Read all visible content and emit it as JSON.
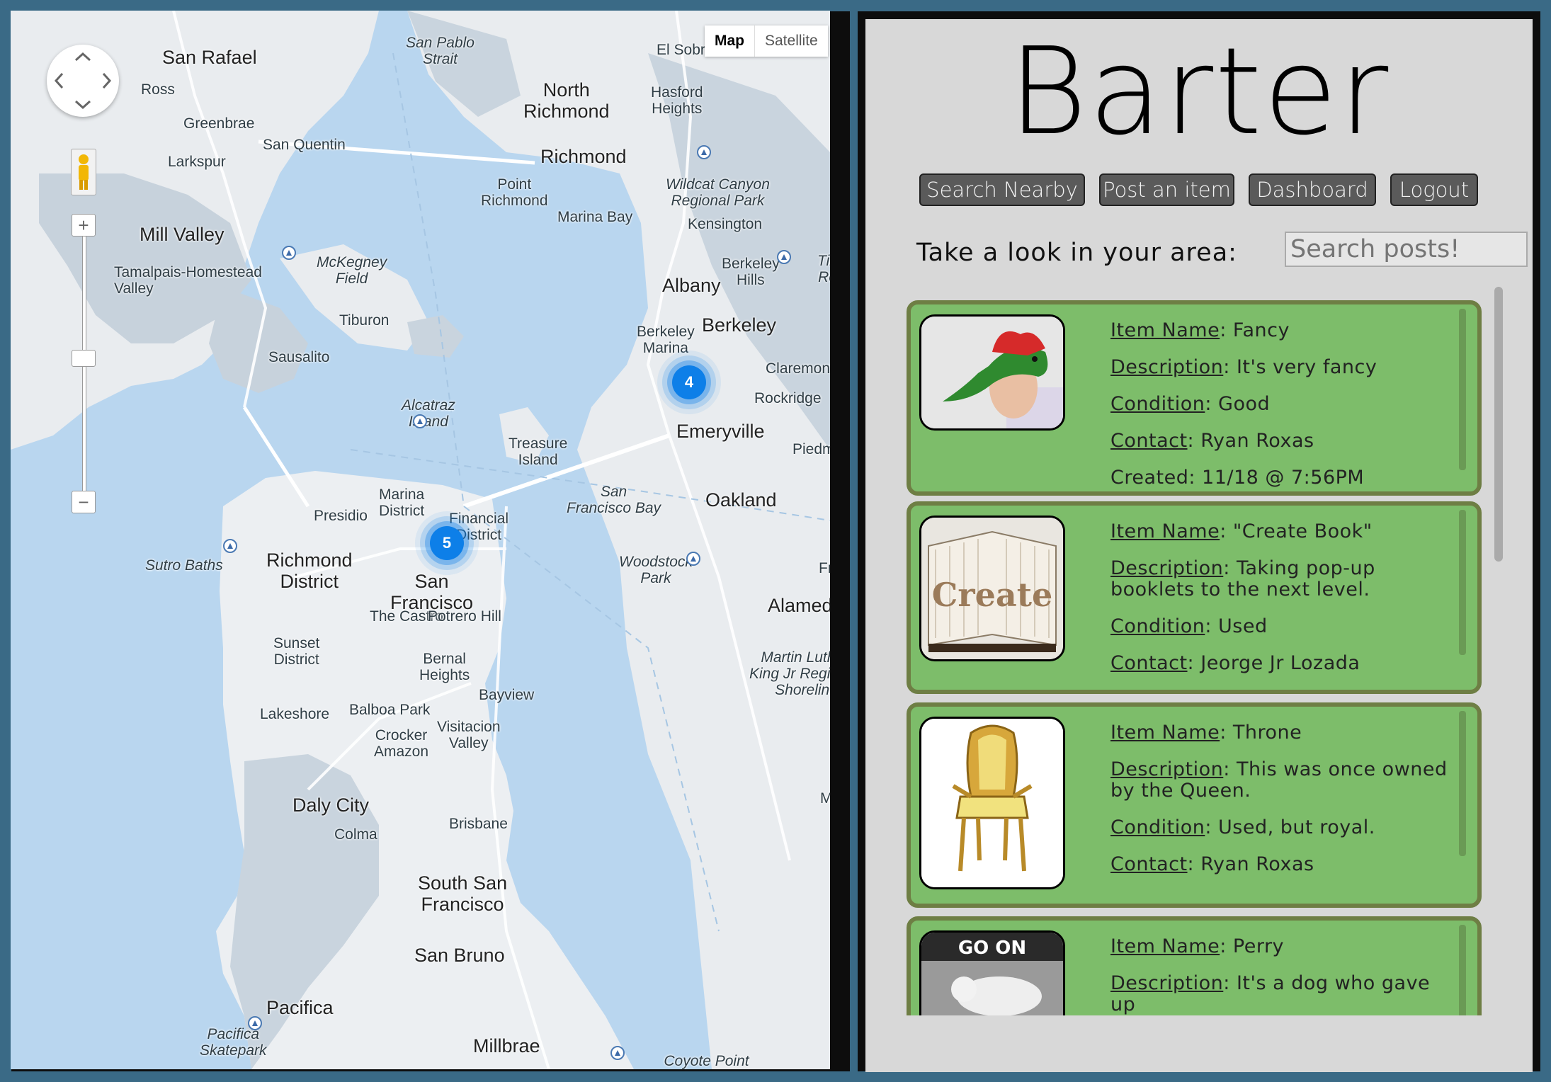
{
  "map": {
    "type_buttons": [
      "Map",
      "Satellite"
    ],
    "zoom_in": "+",
    "zoom_out": "−",
    "clusters": [
      "4",
      "5"
    ],
    "places": [
      "San Rafael",
      "Ross",
      "Greenbrae",
      "San Quentin",
      "Larkspur",
      "Mill Valley",
      "Tamalpais-Homestead\nValley",
      "McKegney\nField",
      "Tiburon",
      "Sausalito",
      "San Pablo\nStrait",
      "El Sobrante",
      "North\nRichmond",
      "Hasford\nHeights",
      "Richmond",
      "Point\nRichmond",
      "Marina Bay",
      "Wildcat Canyon\nRegional Park",
      "Kensington",
      "Berkeley\nHills",
      "Tilden\nRegio",
      "Albany",
      "Berkeley\nMarina",
      "Berkeley",
      "Claremont",
      "Rockridge",
      "Emeryville",
      "Piedmont",
      "Alcatraz\nIsland",
      "Treasure\nIsland",
      "San\nFrancisco Bay",
      "Oakland",
      "Marina\nDistrict",
      "Presidio",
      "Financial\nDistrict",
      "Sutro Baths",
      "Richmond\nDistrict",
      "San\nFrancisco",
      "The Castro",
      "Potrero Hill",
      "Woodstock\nPark",
      "Fruitv",
      "Alameda",
      "Sunset\nDistrict",
      "Bernal\nHeights",
      "Bayview",
      "Martin Luthe\nKing Jr Regiona\nShorelin",
      "Lakeshore",
      "Balboa Park",
      "Visitacion\nValley",
      "Crocker\nAmazon",
      "Daly City",
      "Colma",
      "Brisbane",
      "Marin",
      "South San\nFrancisco",
      "San Bruno",
      "Pacifica",
      "Pacifica\nSkatepark",
      "Millbrae",
      "Coyote Point\nRecreation Area"
    ]
  },
  "app": {
    "logo": "Barter",
    "nav": [
      "Search Nearby",
      "Post an item",
      "Dashboard",
      "Logout"
    ],
    "search_label": "Take a look in your area:",
    "search_placeholder": "Search posts!",
    "posts": [
      {
        "image": "dinosaur-hat-photo",
        "fields": [
          {
            "k": "Item Name",
            "v": "Fancy"
          },
          {
            "k": "Description",
            "v": "It's very fancy"
          },
          {
            "k": "Condition",
            "v": "Good"
          },
          {
            "k": "Contact",
            "v": "Ryan Roxas"
          }
        ],
        "created": "Created: 11/18 @ 7:56PM"
      },
      {
        "image": "create-book-photo",
        "image_text": "Create",
        "fields": [
          {
            "k": "Item Name",
            "v": "\"Create Book\""
          },
          {
            "k": "Description",
            "v": "Taking pop-up booklets to the next level."
          },
          {
            "k": "Condition",
            "v": "Used"
          },
          {
            "k": "Contact",
            "v": "Jeorge Jr Lozada"
          }
        ]
      },
      {
        "image": "golden-throne-photo",
        "fields": [
          {
            "k": "Item Name",
            "v": "Throne"
          },
          {
            "k": "Description",
            "v": "This was once owned by the Queen."
          },
          {
            "k": "Condition",
            "v": "Used, but royal."
          },
          {
            "k": "Contact",
            "v": "Ryan Roxas"
          }
        ]
      },
      {
        "image": "go-on-dog-photo",
        "image_text": "GO ON",
        "fields": [
          {
            "k": "Item Name",
            "v": "Perry"
          },
          {
            "k": "Description",
            "v": "It's a dog who gave up"
          }
        ]
      }
    ]
  }
}
